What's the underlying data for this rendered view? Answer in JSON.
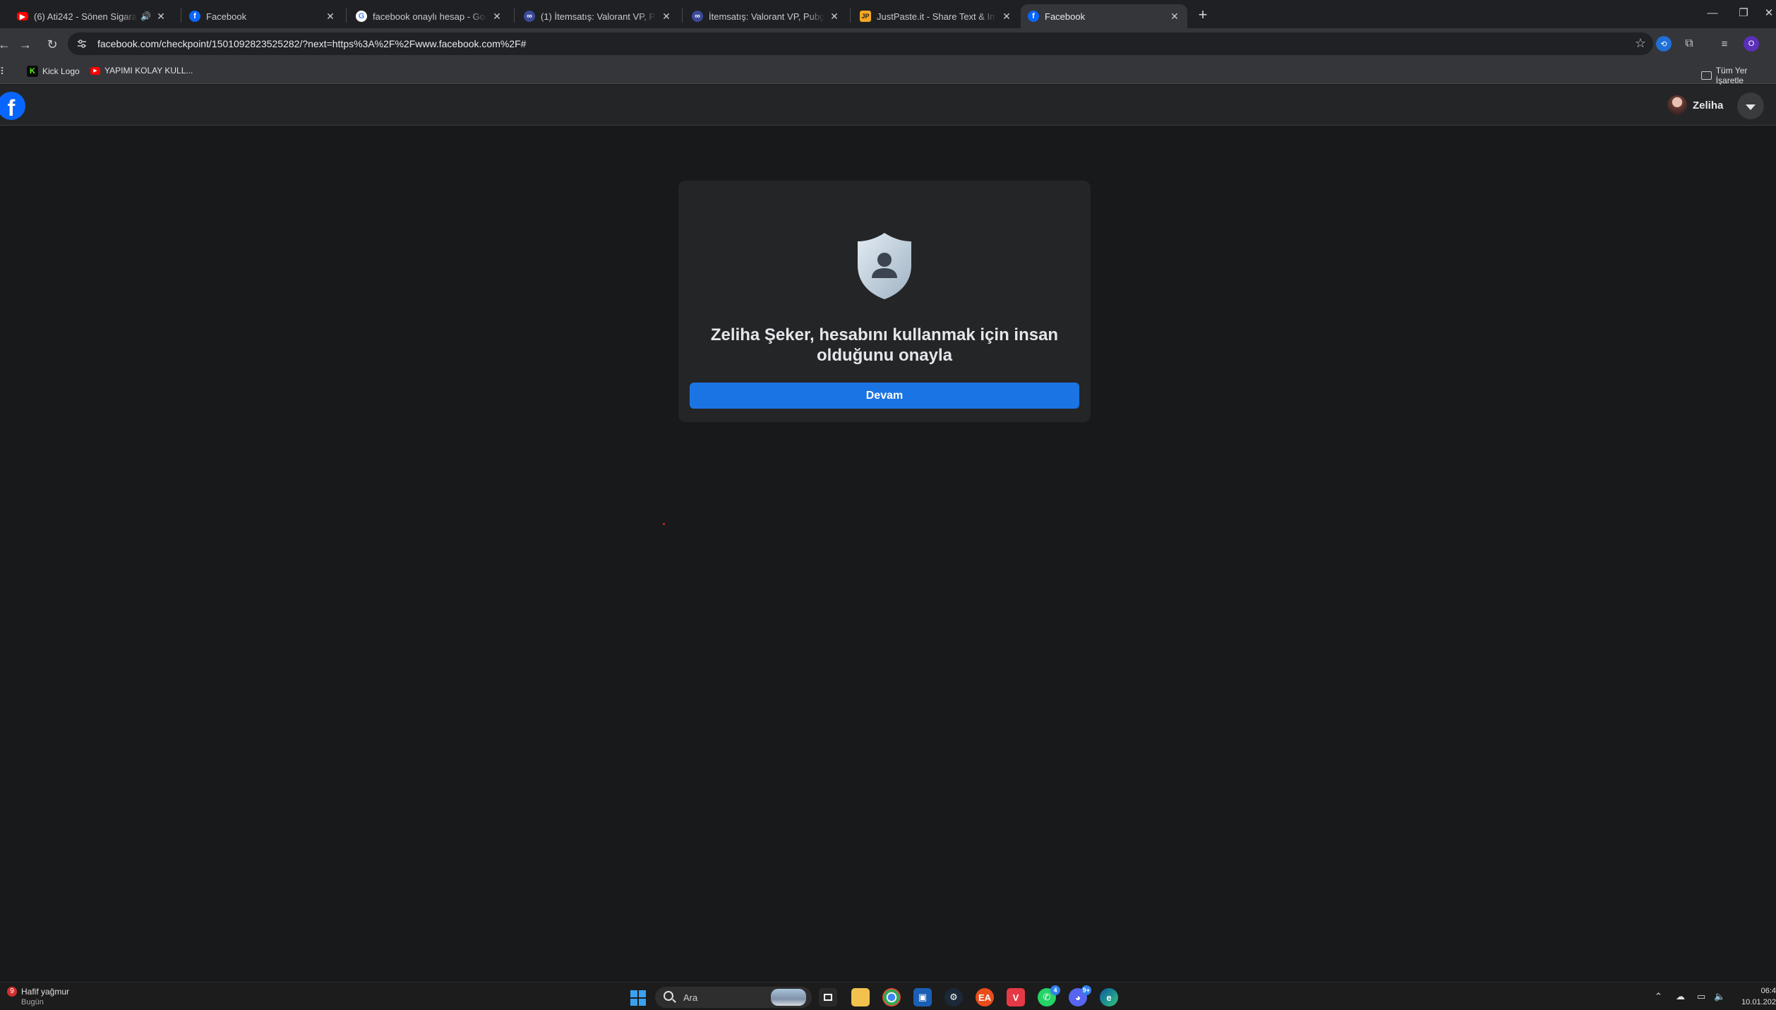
{
  "browser": {
    "tabs": [
      {
        "title": "(6) Ati242 - Sönen Sigaralar",
        "favicon": "youtube-icon"
      },
      {
        "title": "Facebook",
        "favicon": "facebook-icon"
      },
      {
        "title": "facebook onaylı hesap - Google",
        "favicon": "google-icon"
      },
      {
        "title": "(1) İtemsatış: Valorant VP, P",
        "favicon": "itemsatis-icon"
      },
      {
        "title": "İtemsatış: Valorant VP, Pubg M",
        "favicon": "itemsatis-icon"
      },
      {
        "title": "JustPaste.it - Share Text & Imag",
        "favicon": "justpaste-icon"
      },
      {
        "title": "Facebook",
        "favicon": "facebook-icon",
        "active": true
      }
    ],
    "url": "facebook.com/checkpoint/1501092823525282/?next=https%3A%2F%2Fwww.facebook.com%2F#",
    "bookmarks": [
      {
        "label": "Kick Logo",
        "icon": "kick-icon"
      },
      {
        "label": "YAPIMI KOLAY KULL...",
        "icon": "youtube-icon"
      }
    ],
    "all_bookmarks_label": "Tüm Yer İşaretle",
    "profile_initial": "O"
  },
  "facebook": {
    "user_name": "Zeliha",
    "card": {
      "title": "Zeliha Şeker, hesabını kullanmak için insan olduğunu onayla",
      "button_label": "Devam"
    },
    "colors": {
      "brand": "#0866ff",
      "button": "#1b74e4",
      "card": "#242526",
      "page": "#18191a"
    }
  },
  "taskbar": {
    "weather_badge": "9",
    "weather_text": "Hafif yağmur",
    "weather_sub": "Bugün",
    "search_placeholder": "Ara",
    "whatsapp_badge": "4",
    "discord_badge": "9+",
    "time": "06:4",
    "date": "10.01.202"
  }
}
